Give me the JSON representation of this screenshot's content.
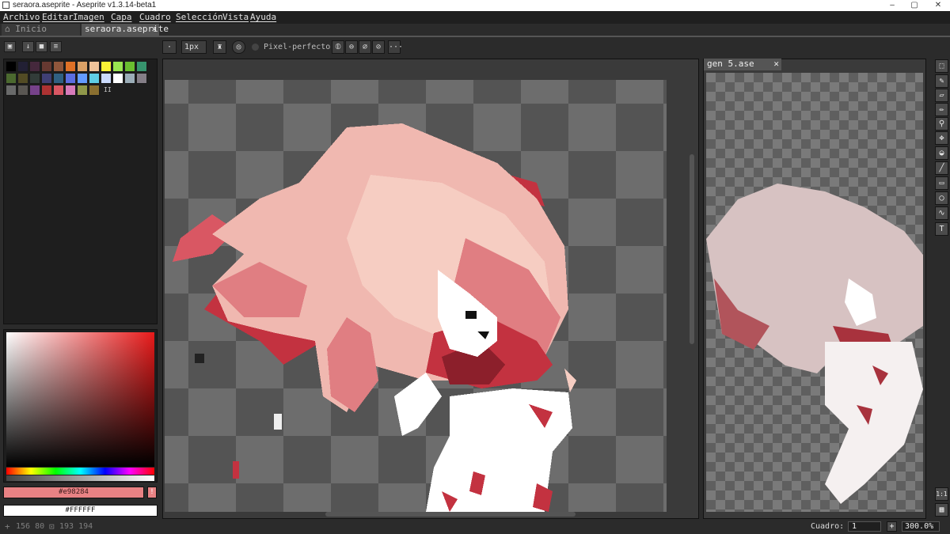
{
  "window": {
    "title": "seraora.aseprite - Aseprite v1.3.14-beta1",
    "minimize": "–",
    "maximize": "▢",
    "close": "✕"
  },
  "menu": [
    "Archivo",
    "Editar",
    "Imagen",
    "Capa",
    "Cuadro",
    "Selección",
    "Vista",
    "Ayuda"
  ],
  "tabs": [
    {
      "label": "Inicio",
      "icon": "home-icon"
    },
    {
      "label": "seraora.aseprite",
      "close": "✕"
    }
  ],
  "preview_tab": {
    "label": "gen 5.ase",
    "close": "✕"
  },
  "context_bar": {
    "brush_size": "1px",
    "pixel_perfect": "Pixel-perfecto",
    "more": "···"
  },
  "colors": {
    "fg_hex": "#e98284",
    "bg_hex": "#FFFFFF",
    "accent": "#e98284"
  },
  "palette": [
    "#000000",
    "#222034",
    "#45283c",
    "#663931",
    "#8f563b",
    "#df7126",
    "#d9a066",
    "#eec39a",
    "#fbf236",
    "#99e550",
    "#6abe30",
    "#37946e",
    "#4b692f",
    "#524b24",
    "#323c39",
    "#3f3f74",
    "#306082",
    "#5b6ee1",
    "#639bff",
    "#5fcde4",
    "#cbdbfc",
    "#ffffff",
    "#9badb7",
    "#847e87",
    "#696a6a",
    "#595652",
    "#76428a",
    "#ac3232",
    "#d95763",
    "#d77bba",
    "#8f974a",
    "#8a6f30"
  ],
  "fg_label": "#e98284",
  "bg_label": "#FFFFFF",
  "status": {
    "cursor": "156 80",
    "selection": "193 194",
    "frame_label": "Cuadro:",
    "frame_value": "1",
    "zoom": "300.0%"
  },
  "zoom_buttons": {
    "one_to_one": "1:1"
  }
}
